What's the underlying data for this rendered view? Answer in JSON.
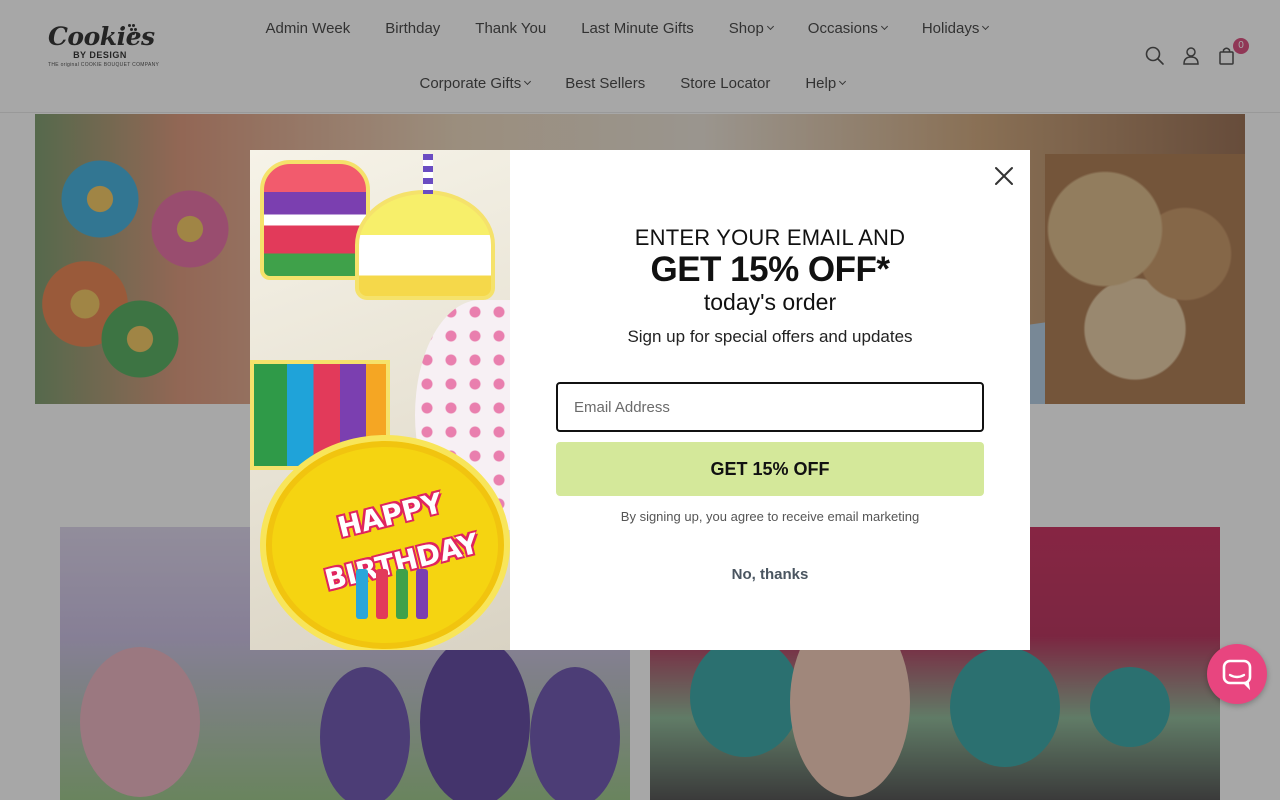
{
  "brand": {
    "logo_main": "Cookies",
    "logo_sub": "BY DESIGN",
    "logo_tagline": "THE original COOKIE BOUQUET COMPANY"
  },
  "nav": {
    "row1": [
      {
        "label": "Admin Week",
        "has_dropdown": false
      },
      {
        "label": "Birthday",
        "has_dropdown": false
      },
      {
        "label": "Thank You",
        "has_dropdown": false
      },
      {
        "label": "Last Minute Gifts",
        "has_dropdown": false
      },
      {
        "label": "Shop",
        "has_dropdown": true
      },
      {
        "label": "Occasions",
        "has_dropdown": true
      },
      {
        "label": "Holidays",
        "has_dropdown": true
      }
    ],
    "row2": [
      {
        "label": "Corporate Gifts",
        "has_dropdown": true
      },
      {
        "label": "Best Sellers",
        "has_dropdown": false
      },
      {
        "label": "Store Locator",
        "has_dropdown": false
      },
      {
        "label": "Help",
        "has_dropdown": true
      }
    ]
  },
  "header_icons": {
    "search": "search-icon",
    "account": "user-icon",
    "cart": "shopping-bag-icon",
    "cart_count": "0"
  },
  "popup": {
    "line1": "ENTER YOUR EMAIL AND",
    "line2": "GET 15% OFF*",
    "line3": "today's order",
    "subtitle": "Sign up for special offers and updates",
    "email_placeholder": "Email Address",
    "email_value": "",
    "submit_label": "GET 15% OFF",
    "legal": "By signing up, you agree to receive email marketing",
    "dismiss_label": "No, thanks",
    "image_text": "HAPPY BIRTHDAY"
  },
  "colors": {
    "accent_button": "#d4e89a",
    "chat_button": "#e8457f",
    "cart_badge": "#d6336c"
  }
}
